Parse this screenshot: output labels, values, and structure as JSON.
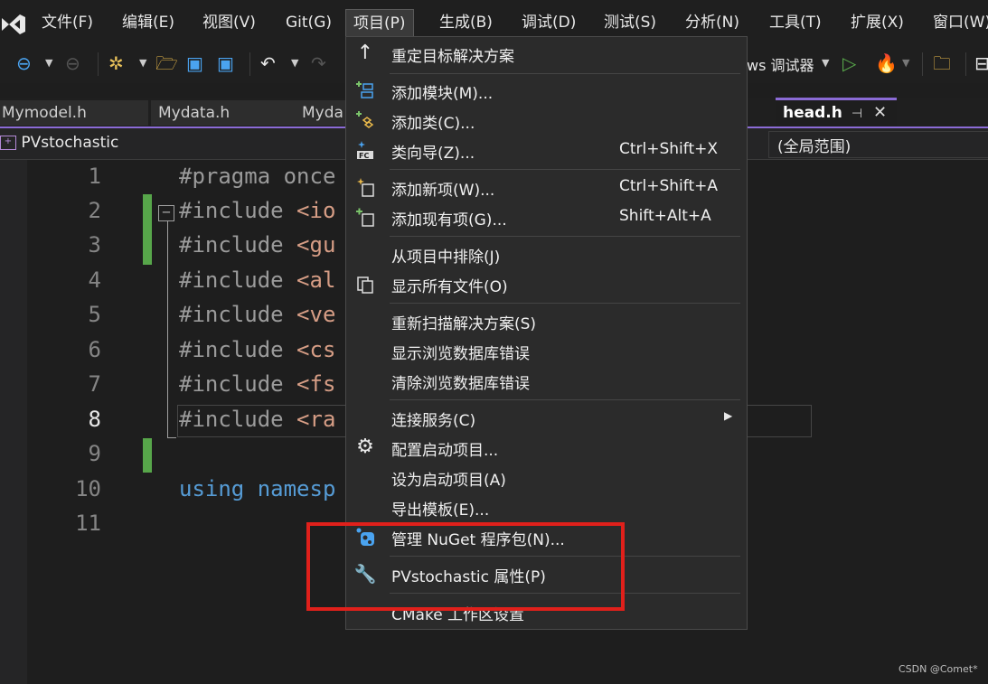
{
  "menubar": {
    "items": [
      "文件(F)",
      "编辑(E)",
      "视图(V)",
      "Git(G)",
      "项目(P)",
      "生成(B)",
      "调试(D)",
      "测试(S)",
      "分析(N)",
      "工具(T)",
      "扩展(X)",
      "窗口(W)"
    ]
  },
  "toolbar": {
    "debugger_label": "ws 调试器"
  },
  "tabs": {
    "items": [
      "Mymodel.h",
      "Mydata.h",
      "Myda"
    ],
    "active": "head.h",
    "pin_glyph": "⊣",
    "close_glyph": "✕"
  },
  "navbar": {
    "project": "PVstochastic",
    "scope": "(全局范围)"
  },
  "editor": {
    "line_numbers": [
      "1",
      "2",
      "3",
      "4",
      "5",
      "6",
      "7",
      "8",
      "9",
      "10",
      "11"
    ],
    "lines": [
      {
        "pre": "#pragma ",
        "rest": "once",
        "pre_class": "kw-grey",
        "rest_class": "kw-grey"
      },
      {
        "pre": "#include ",
        "rest": "<io",
        "pre_class": "kw-grey",
        "rest_class": "str"
      },
      {
        "pre": "#include ",
        "rest": "<gu",
        "pre_class": "kw-grey",
        "rest_class": "str"
      },
      {
        "pre": "#include ",
        "rest": "<al",
        "pre_class": "kw-grey",
        "rest_class": "str"
      },
      {
        "pre": "#include ",
        "rest": "<ve",
        "pre_class": "kw-grey",
        "rest_class": "str"
      },
      {
        "pre": "#include ",
        "rest": "<cs",
        "pre_class": "kw-grey",
        "rest_class": "str"
      },
      {
        "pre": "#include ",
        "rest": "<fs",
        "pre_class": "kw-grey",
        "rest_class": "str"
      },
      {
        "pre": "#include ",
        "rest": "<ra",
        "pre_class": "kw-grey",
        "rest_class": "str"
      },
      {
        "pre": "",
        "rest": "",
        "pre_class": "kw-grey",
        "rest_class": "kw-grey"
      },
      {
        "pre": "using ",
        "rest": "namesp",
        "pre_class": "kw-blue",
        "rest_class": "kw-blue"
      },
      {
        "pre": "",
        "rest": "",
        "pre_class": "kw-grey",
        "rest_class": "kw-grey"
      }
    ],
    "collapse_glyph": "−"
  },
  "project_menu": {
    "items": [
      {
        "label": "重定目标解决方案",
        "shortcut": "",
        "icon": "arrow-up-icon"
      },
      {
        "label": "添加模块(M)...",
        "shortcut": "",
        "icon": "add-module-icon"
      },
      {
        "label": "添加类(C)...",
        "shortcut": "",
        "icon": "add-class-icon"
      },
      {
        "label": "类向导(Z)...",
        "shortcut": "Ctrl+Shift+X",
        "icon": "class-wizard-icon"
      },
      {
        "label": "添加新项(W)...",
        "shortcut": "Ctrl+Shift+A",
        "icon": "add-new-item-icon"
      },
      {
        "label": "添加现有项(G)...",
        "shortcut": "Shift+Alt+A",
        "icon": "add-existing-item-icon"
      },
      {
        "label": "从项目中排除(J)",
        "shortcut": "",
        "icon": ""
      },
      {
        "label": "显示所有文件(O)",
        "shortcut": "",
        "icon": "show-all-files-icon"
      },
      {
        "label": "重新扫描解决方案(S)",
        "shortcut": "",
        "icon": ""
      },
      {
        "label": "显示浏览数据库错误",
        "shortcut": "",
        "icon": ""
      },
      {
        "label": "清除浏览数据库错误",
        "shortcut": "",
        "icon": ""
      },
      {
        "label": "连接服务(C)",
        "shortcut": "",
        "icon": ""
      },
      {
        "label": "配置启动项目...",
        "shortcut": "",
        "icon": "gear-icon"
      },
      {
        "label": "设为启动项目(A)",
        "shortcut": "",
        "icon": ""
      },
      {
        "label": "导出模板(E)...",
        "shortcut": "",
        "icon": ""
      },
      {
        "label": "管理 NuGet 程序包(N)...",
        "shortcut": "",
        "icon": "nuget-icon"
      },
      {
        "label": "PVstochastic 属性(P)",
        "shortcut": "",
        "icon": "wrench-icon"
      },
      {
        "label": "CMake 工作区设置",
        "shortcut": "",
        "icon": ""
      }
    ],
    "submenu_arrow": "▶"
  },
  "watermark": "CSDN @Comet*",
  "colors": {
    "highlight": "#e0201b",
    "accent": "#8b6bd6",
    "change_bar": "#57a64a"
  }
}
